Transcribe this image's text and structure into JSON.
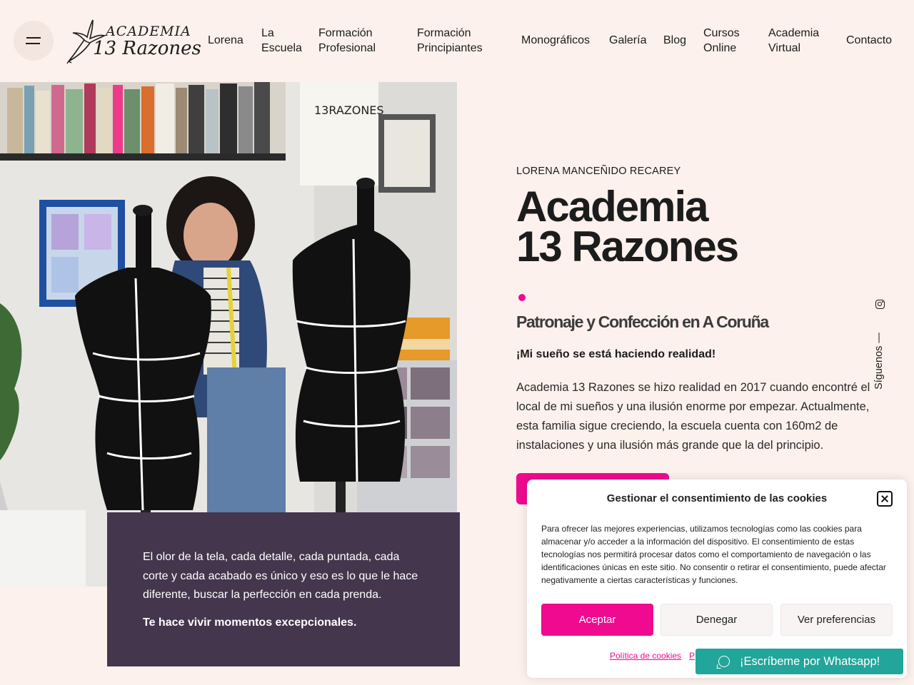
{
  "header": {
    "logo_line1": "ACADEMIA",
    "logo_line2": "13 Razones",
    "nav": [
      {
        "label": "Lorena"
      },
      {
        "label": "La\nEscuela"
      },
      {
        "label": "Formación\nProfesional"
      },
      {
        "label": "Formación\nPrincipiantes"
      },
      {
        "label": "Monográficos"
      },
      {
        "label": "Galería"
      },
      {
        "label": "Blog"
      },
      {
        "label": "Cursos\nOnline"
      },
      {
        "label": "Academia\nVirtual"
      },
      {
        "label": "Contacto"
      }
    ]
  },
  "hero": {
    "eyebrow": "LORENA MANCEÑIDO RECAREY",
    "title_line1": "Academia",
    "title_line2": "13 Razones",
    "subtitle": "Patronaje y Confección en A Coruña",
    "lead": "¡Mi sueño se está haciendo realidad!",
    "body": "Academia 13 Razones se hizo realidad en 2017 cuando encontré el local de mi sueños y una ilusión enorme por empezar. Actualmente, esta familia sigue creciendo, la escuela cuenta con 160m2 de instalaciones y una ilusión más grande que la del principio.",
    "accent_color": "#ef0a8f"
  },
  "quote": {
    "text": "El olor de la tela, cada detalle, cada puntada, cada corte y cada acabado es único y eso es lo que le hace diferente, buscar la perfección en cada prenda.",
    "strong": "Te hace vivir momentos excepcionales."
  },
  "social": {
    "label": "Síguenos —",
    "icon": "instagram-icon"
  },
  "cookie": {
    "title": "Gestionar el consentimiento de las cookies",
    "text": "Para ofrecer las mejores experiencias, utilizamos tecnologías como las cookies para almacenar y/o acceder a la información del dispositivo. El consentimiento de estas tecnologías nos permitirá procesar datos como el comportamiento de navegación o las identificaciones únicas en este sitio. No consentir o retirar el consentimiento, puede afectar negativamente a ciertas características y funciones.",
    "accept": "Aceptar",
    "deny": "Denegar",
    "prefs": "Ver preferencias",
    "link1": "Política de cookies",
    "link2": "P"
  },
  "whatsapp": {
    "label": "¡Escríbeme por Whatsapp!",
    "color": "#22a59a"
  }
}
